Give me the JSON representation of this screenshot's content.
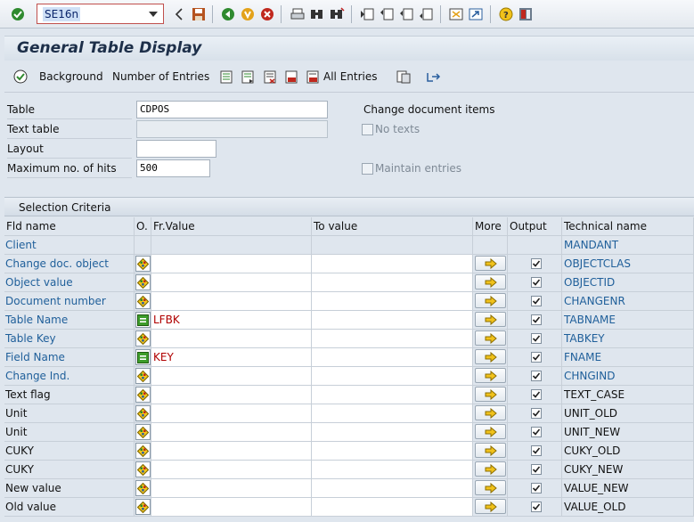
{
  "toolbar": {
    "command_field": "SE16n",
    "icons": [
      "enter-icon",
      "back-icon",
      "save-icon",
      "back-green-icon",
      "exit-icon",
      "cancel-icon",
      "print-icon",
      "find-icon",
      "find-next-icon",
      "first-page-icon",
      "prev-page-icon",
      "next-page-icon",
      "last-page-icon",
      "new-session-icon",
      "shortcut-icon",
      "help-icon",
      "customize-layout-icon"
    ]
  },
  "title": "General Table Display",
  "app_toolbar": {
    "background_label": "Background",
    "number_of_entries_label": "Number of Entries",
    "all_entries_label": "All Entries"
  },
  "form": {
    "table_label": "Table",
    "table_value": "CDPOS",
    "text_table_label": "Text table",
    "text_table_value": "",
    "layout_label": "Layout",
    "layout_value": "",
    "max_hits_label": "Maximum no. of hits",
    "max_hits_value": "500",
    "table_description": "Change document items",
    "no_texts_label": "No texts",
    "maintain_entries_label": "Maintain entries"
  },
  "selection": {
    "section_title": "Selection Criteria",
    "columns": {
      "fld_name": "Fld name",
      "option": "O.",
      "fr_value": "Fr.Value",
      "to_value": "To value",
      "more": "More",
      "output": "Output",
      "technical_name": "Technical name"
    },
    "rows": [
      {
        "field": "Client",
        "key": true,
        "option": "none",
        "fr_value": "",
        "to_value": "",
        "more": false,
        "output": false,
        "technical": "MANDANT"
      },
      {
        "field": "Change doc. object",
        "key": true,
        "option": "select",
        "fr_value": "",
        "to_value": "",
        "more": true,
        "output": true,
        "technical": "OBJECTCLAS"
      },
      {
        "field": "Object value",
        "key": true,
        "option": "select",
        "fr_value": "",
        "to_value": "",
        "more": true,
        "output": true,
        "technical": "OBJECTID"
      },
      {
        "field": "Document number",
        "key": true,
        "option": "select",
        "fr_value": "",
        "to_value": "",
        "more": true,
        "output": true,
        "technical": "CHANGENR"
      },
      {
        "field": "Table Name",
        "key": true,
        "option": "equals",
        "fr_value": "LFBK",
        "to_value": "",
        "more": true,
        "output": true,
        "technical": "TABNAME"
      },
      {
        "field": "Table Key",
        "key": true,
        "option": "select",
        "fr_value": "",
        "to_value": "",
        "more": true,
        "output": true,
        "technical": "TABKEY"
      },
      {
        "field": "Field Name",
        "key": true,
        "option": "equals",
        "fr_value": "KEY",
        "to_value": "",
        "more": true,
        "output": true,
        "technical": "FNAME"
      },
      {
        "field": "Change Ind.",
        "key": true,
        "option": "select",
        "fr_value": "",
        "to_value": "",
        "more": true,
        "output": true,
        "technical": "CHNGIND"
      },
      {
        "field": "Text flag",
        "key": false,
        "option": "select",
        "fr_value": "",
        "to_value": "",
        "more": true,
        "output": true,
        "technical": "TEXT_CASE"
      },
      {
        "field": "Unit",
        "key": false,
        "option": "select",
        "fr_value": "",
        "to_value": "",
        "more": true,
        "output": true,
        "technical": "UNIT_OLD"
      },
      {
        "field": "Unit",
        "key": false,
        "option": "select",
        "fr_value": "",
        "to_value": "",
        "more": true,
        "output": true,
        "technical": "UNIT_NEW"
      },
      {
        "field": "CUKY",
        "key": false,
        "option": "select",
        "fr_value": "",
        "to_value": "",
        "more": true,
        "output": true,
        "technical": "CUKY_OLD"
      },
      {
        "field": "CUKY",
        "key": false,
        "option": "select",
        "fr_value": "",
        "to_value": "",
        "more": true,
        "output": true,
        "technical": "CUKY_NEW"
      },
      {
        "field": "New value",
        "key": false,
        "option": "select",
        "fr_value": "",
        "to_value": "",
        "more": true,
        "output": true,
        "technical": "VALUE_NEW"
      },
      {
        "field": "Old value",
        "key": false,
        "option": "select",
        "fr_value": "",
        "to_value": "",
        "more": true,
        "output": true,
        "technical": "VALUE_OLD"
      }
    ]
  },
  "colors": {
    "key_field": "#1f5f9a",
    "value_red": "#b00000",
    "background": "#dfe6ee"
  }
}
